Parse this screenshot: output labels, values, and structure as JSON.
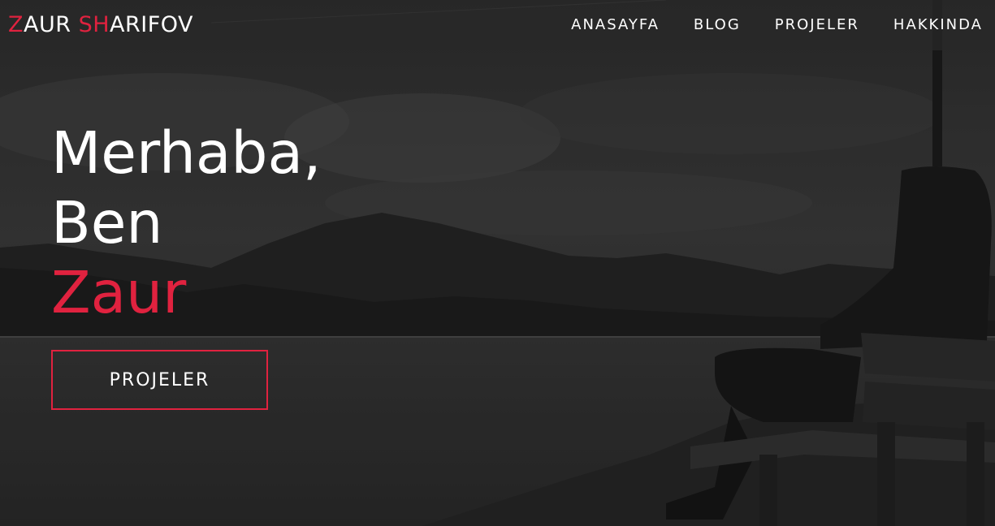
{
  "brand": {
    "logo_white_1": "Z",
    "logo_red_1": "",
    "logo_white_a": "AUR ",
    "logo_red_2": "SH",
    "logo_white_b": "ARIFOV"
  },
  "nav": {
    "items": [
      {
        "label": "ANASAYFA"
      },
      {
        "label": "BLOG"
      },
      {
        "label": "PROJELER"
      },
      {
        "label": "HAKKINDA"
      }
    ]
  },
  "hero": {
    "greeting": "Merhaba,",
    "intro": "Ben",
    "name": "Zaur",
    "cta_label": "PROJELER"
  },
  "colors": {
    "accent": "#e0223f",
    "navbar_bg": "#282828",
    "text": "#ffffff"
  }
}
